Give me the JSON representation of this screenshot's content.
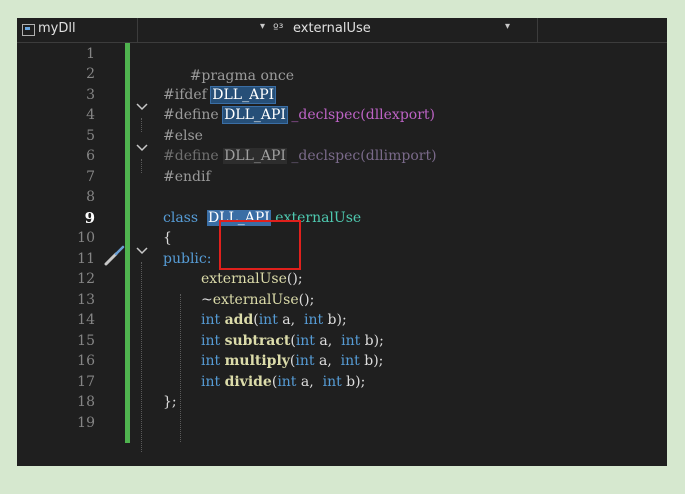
{
  "navbar": {
    "project": "myDll",
    "class_icon": "º³",
    "class_name": "externalUse"
  },
  "line_numbers": [
    "1",
    "2",
    "3",
    "4",
    "5",
    "6",
    "7",
    "8",
    "9",
    "10",
    "11",
    "12",
    "13",
    "14",
    "15",
    "16",
    "17",
    "18",
    "19"
  ],
  "current_line": "9",
  "code": {
    "l1": "#pragma once",
    "l3_a": "#ifdef ",
    "l3_b": "DLL_API",
    "l4_a": "#define ",
    "l4_b": "DLL_API",
    "l4_c": " _declspec",
    "l4_d": "(dllexport)",
    "l5": "#else",
    "l6_a": "#define ",
    "l6_b": "DLL_API",
    "l6_c": " _declspec",
    "l6_d": "(dllimport)",
    "l7": "#endif",
    "l9_a": "class  ",
    "l9_b": "DLL_API",
    "l9_c": " externalUse",
    "l10": "{",
    "l11": "public:",
    "l12_a": "externalUse",
    "l12_b": "();",
    "l13_a": "~",
    "l13_b": "externalUse",
    "l13_c": "();",
    "l14_a": "int ",
    "l14_b": "add",
    "l14_c": "(",
    "l14_d": "int",
    "l14_e": " a,  ",
    "l14_f": "int",
    "l14_g": " b);",
    "l15_b": "subtract",
    "l16_b": "multiply",
    "l17_b": "divide",
    "l18": "};"
  },
  "colors": {
    "background": "#1f1f1f",
    "change_bar": "#4fb34f",
    "annotation_box": "#e0201c"
  }
}
